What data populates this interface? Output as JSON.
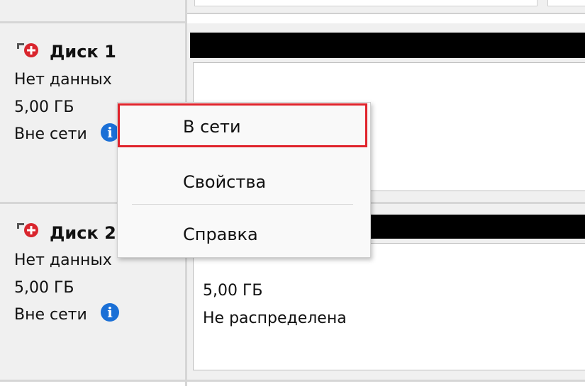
{
  "disks": [
    {
      "title": "Диск 1",
      "type": "Нет данных",
      "size": "5,00 ГБ",
      "status": "Вне сети",
      "icon": "disk-offline-icon"
    },
    {
      "title": "Диск 2",
      "type": "Нет данных",
      "size": "5,00 ГБ",
      "status": "Вне сети",
      "icon": "disk-offline-icon"
    }
  ],
  "volume2": {
    "size": "5,00 ГБ",
    "status": "Не распределена"
  },
  "context_menu": {
    "items": [
      {
        "label": "В сети",
        "highlighted": true
      },
      {
        "label": "Свойства"
      },
      {
        "label": "Справка"
      }
    ]
  },
  "colors": {
    "highlight_border": "#e0232b",
    "info_blue": "#1a6fd6",
    "offline_red": "#d9262e"
  }
}
